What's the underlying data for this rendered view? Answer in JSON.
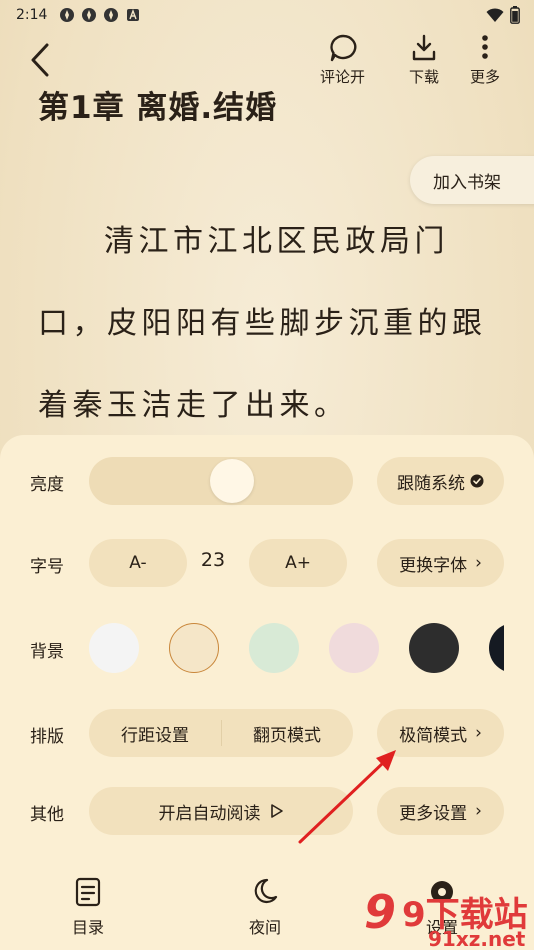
{
  "status_bar": {
    "time": "2:14",
    "notification_icons": [
      "app-icon",
      "app-icon",
      "app-icon",
      "a-icon"
    ],
    "right_icons": [
      "wifi-icon",
      "battery-icon"
    ]
  },
  "top_nav": {
    "comments_label": "评论开",
    "download_label": "下载",
    "more_label": "更多"
  },
  "reader": {
    "chapter_title": "第1章 离婚.结婚",
    "add_to_shelf": "加入书架",
    "lines": [
      "清江市江北区民政局门",
      "口，皮阳阳有些脚步沉重的跟",
      "着秦玉洁走了出来。"
    ]
  },
  "settings": {
    "brightness_label": "亮度",
    "brightness_level_percent": 55,
    "follow_system_label": "跟随系统",
    "font_size_label": "字号",
    "font_decrease": "A-",
    "font_size_value": "23",
    "font_increase": "A+",
    "change_font_label": "更换字体",
    "background_label": "背景",
    "background_colors": [
      "#f4f4f4",
      "#f5e6c8",
      "#d8ead6",
      "#f0dbdc",
      "#2d2d2d",
      "#151a22"
    ],
    "selected_background_index": 1,
    "layout_label": "排版",
    "line_spacing_label": "行距设置",
    "page_turn_label": "翻页模式",
    "minimal_mode_label": "极简模式",
    "other_label": "其他",
    "auto_read_label": "开启自动阅读",
    "more_settings_label": "更多设置"
  },
  "bottom_tabs": {
    "toc_label": "目录",
    "night_label": "夜间",
    "settings_label": "设置"
  },
  "watermark": {
    "text_main": "9下载站",
    "text_sub": "91xz.net"
  },
  "colors": {
    "panel_bg": "#fbefd3",
    "pill_bg": "#f2e1bd",
    "text": "#2a2118",
    "accent_ring": "#c9873b",
    "annotation_arrow": "#e02020",
    "watermark_red": "#e03a3a"
  }
}
